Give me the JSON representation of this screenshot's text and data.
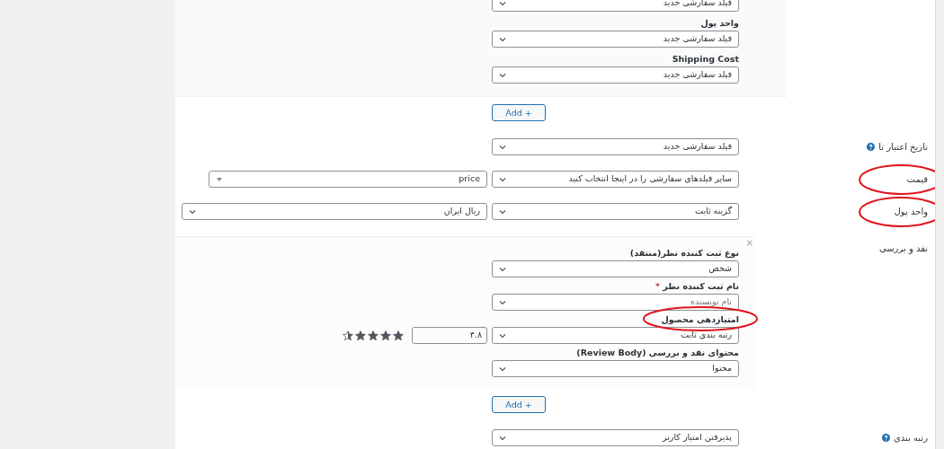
{
  "top_group": {
    "fields": [
      {
        "value": "فیلد سفارشی جدید"
      },
      {
        "label": "واحد پول",
        "value": "فیلد سفارشی جدید"
      },
      {
        "label": "Shipping Cost",
        "value": "فیلد سفارشی جدید"
      }
    ],
    "add_button": "Add +"
  },
  "rows": [
    {
      "kind": "selects",
      "label": "تاریخ اعتبار تا",
      "help": true,
      "highlighted": false,
      "selects": [
        {
          "kind": "select",
          "value": "فیلد سفارشی جدید"
        }
      ]
    },
    {
      "kind": "selects",
      "label": "قیمت",
      "help": false,
      "highlighted": true,
      "selects": [
        {
          "kind": "select",
          "value": "سایر فیلدهای سفارشی را در اینجا انتخاب کنید"
        },
        {
          "kind": "combo",
          "value": "price"
        }
      ]
    },
    {
      "kind": "selects",
      "label": "واحد پول",
      "help": false,
      "highlighted": true,
      "selects": [
        {
          "kind": "select",
          "value": "گزینه ثابت"
        },
        {
          "kind": "wide",
          "value": "ریال ایران"
        }
      ]
    },
    {
      "kind": "review",
      "label": "نقد و بررسی",
      "help": false,
      "highlighted": false,
      "close": "×",
      "fields": [
        {
          "label": "نوع ثبت کننده نظر(منتقد)",
          "highlighted": false,
          "value": "شخص"
        },
        {
          "label": "نام ثبت کننده نظر",
          "required_mark": "*",
          "highlighted": false,
          "placeholder": "نام نویسنده"
        },
        {
          "label": "امتیازدهی محصول",
          "highlighted": true,
          "value": "رتبه بندی ثابت",
          "rating": "۴.۸",
          "stars": 4.5
        },
        {
          "label": "محتوای نقد و بررسی (Review Body)",
          "highlighted": false,
          "value": "محتوا"
        }
      ],
      "add_button": "Add +"
    },
    {
      "kind": "selects",
      "label": "رتبه بندی",
      "help": true,
      "highlighted": false,
      "selects": [
        {
          "kind": "select",
          "value": "پذیرفتن امتیاز کاربر"
        }
      ]
    }
  ]
}
